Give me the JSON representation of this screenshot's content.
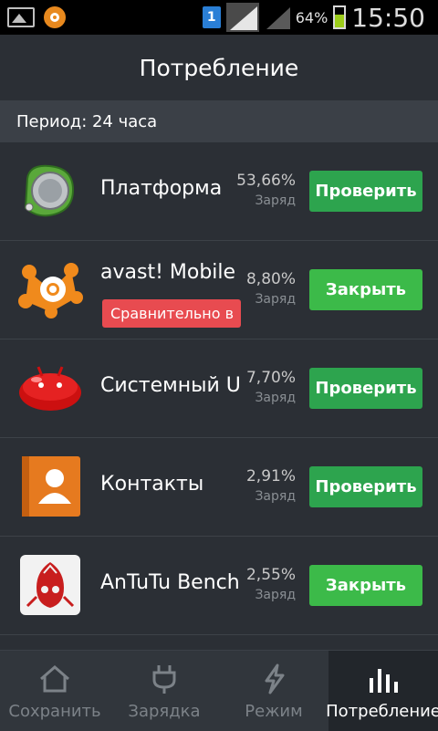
{
  "status_bar": {
    "sim_slot": "1",
    "battery_percent": "64%",
    "battery_level": 0.64,
    "time": "15:50"
  },
  "header": {
    "title": "Потребление",
    "period": "Период: 24 часа"
  },
  "apps": [
    {
      "name": "Платформа",
      "percent": "53,66%",
      "sub": "Заряд",
      "action": "Проверить",
      "badge": null,
      "icon": "platform-icon"
    },
    {
      "name": "avast! Mobile",
      "percent": "8,80%",
      "sub": "Заряд",
      "action": "Закрыть",
      "badge": "Сравнительно в",
      "icon": "avast-icon"
    },
    {
      "name": "Системный U",
      "percent": "7,70%",
      "sub": "Заряд",
      "action": "Проверить",
      "badge": null,
      "icon": "android-jellybean-icon"
    },
    {
      "name": "Контакты",
      "percent": "2,91%",
      "sub": "Заряд",
      "action": "Проверить",
      "badge": null,
      "icon": "contacts-icon"
    },
    {
      "name": "AnTuTu Bench",
      "percent": "2,55%",
      "sub": "Заряд",
      "action": "Закрыть",
      "badge": null,
      "icon": "antutu-icon"
    }
  ],
  "nav": {
    "items": [
      {
        "label": "Сохранить",
        "icon": "home-icon"
      },
      {
        "label": "Зарядка",
        "icon": "plug-icon"
      },
      {
        "label": "Режим",
        "icon": "lightning-icon"
      },
      {
        "label": "Потребление",
        "icon": "bar-chart-icon"
      }
    ],
    "active_index": 3
  },
  "colors": {
    "background": "#2b2f35",
    "accent_green": "#2da44e",
    "badge_red": "#e84b50",
    "active_nav": "#22262b"
  }
}
